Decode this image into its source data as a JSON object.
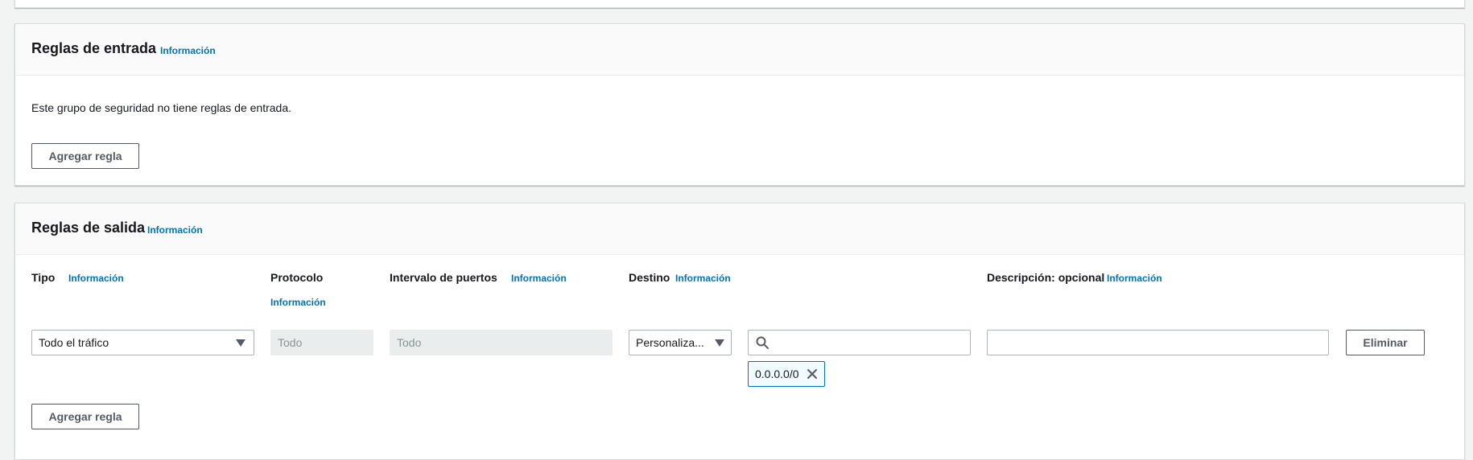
{
  "inbound": {
    "title": "Reglas de entrada",
    "info": "Información",
    "empty_message": "Este grupo de seguridad no tiene reglas de entrada.",
    "add_rule_label": "Agregar regla"
  },
  "outbound": {
    "title": "Reglas de salida",
    "info": "Información",
    "columns": {
      "type": {
        "label": "Tipo",
        "info": "Información"
      },
      "protocol": {
        "label": "Protocolo",
        "info": "Información"
      },
      "port_range": {
        "label": "Intervalo de puertos",
        "info": "Información"
      },
      "destination": {
        "label": "Destino",
        "info": "Información"
      },
      "description": {
        "label": "Descripción: opcional",
        "info": "Información"
      }
    },
    "rule": {
      "type_value": "Todo el tráfico",
      "protocol_value": "Todo",
      "port_range_value": "Todo",
      "destination_type": "Personaliza...",
      "destination_search_value": "",
      "destination_token": "0.0.0.0/0",
      "description_value": "",
      "delete_label": "Eliminar"
    },
    "add_rule_label": "Agregar regla"
  },
  "colors": {
    "accent_link": "#0073bb",
    "button_border": "#545b64",
    "background": "#f2f3f3"
  },
  "icons": [
    "caret-down-icon",
    "search-icon",
    "close-icon"
  ]
}
